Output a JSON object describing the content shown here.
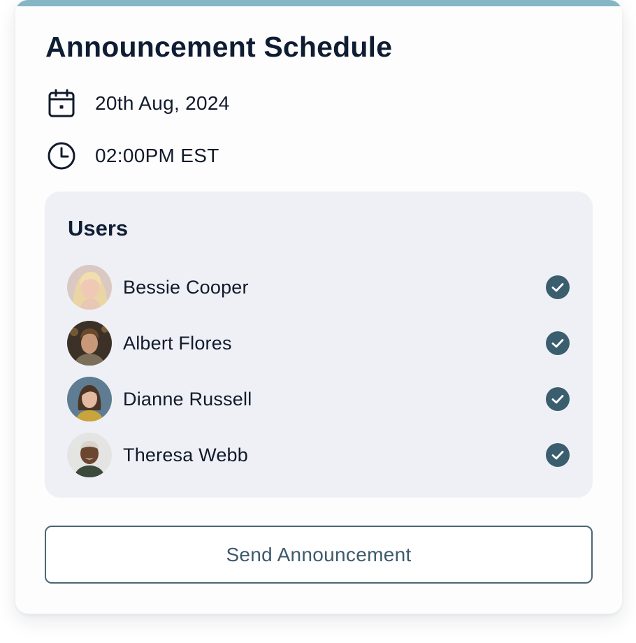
{
  "card": {
    "title": "Announcement Schedule",
    "accent_color": "#84b6c4",
    "date": {
      "icon": "calendar-icon",
      "text": "20th Aug, 2024"
    },
    "time": {
      "icon": "clock-icon",
      "text": "02:00PM EST"
    }
  },
  "users": {
    "heading": "Users",
    "check_color": "#3b5e6f",
    "items": [
      {
        "name": "Bessie Cooper",
        "avatar": "avatar-blonde-woman",
        "selected": true,
        "icon": "check-circle-icon"
      },
      {
        "name": "Albert Flores",
        "avatar": "avatar-man",
        "selected": true,
        "icon": "check-circle-icon"
      },
      {
        "name": "Dianne Russell",
        "avatar": "avatar-woman-brunette",
        "selected": true,
        "icon": "check-circle-icon"
      },
      {
        "name": "Theresa Webb",
        "avatar": "avatar-smiling-woman",
        "selected": true,
        "icon": "check-circle-icon"
      }
    ]
  },
  "actions": {
    "send_label": "Send Announcement"
  }
}
